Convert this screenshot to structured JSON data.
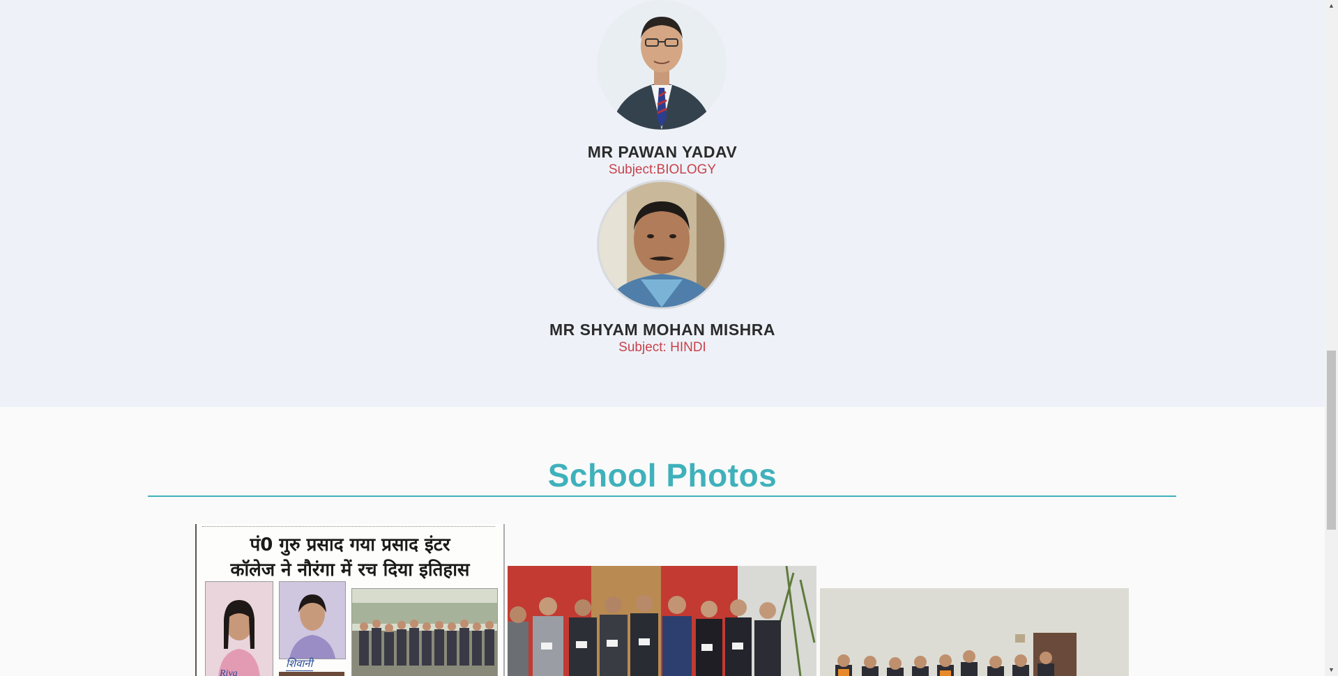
{
  "faculty": {
    "members": [
      {
        "name": "MR PAWAN YADAV",
        "subject": "Subject:BIOLOGY"
      },
      {
        "name": "MR SHYAM MOHAN MISHRA",
        "subject": "Subject: HINDI"
      }
    ]
  },
  "photos": {
    "title": "School Photos",
    "newspaper": {
      "headline_line1": "पं0 गुरु प्रसाद गया प्रसाद इंटर",
      "headline_line2": "कॉलेज ने नौरंगा में रच दिया इतिहास",
      "caption_shivani": "शिवानी",
      "caption_riya": "Riya"
    }
  },
  "colors": {
    "accent": "#3fb1bb",
    "subject": "#c8414b",
    "faculty_bg": "#eef2f8"
  }
}
